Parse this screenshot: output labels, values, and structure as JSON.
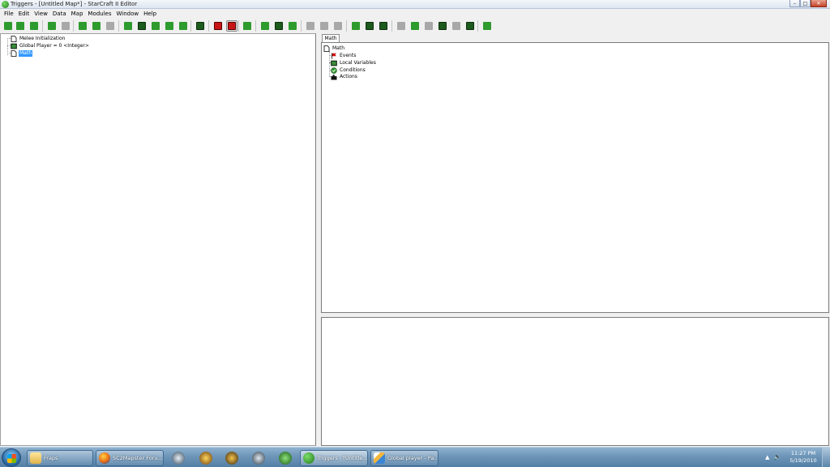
{
  "window": {
    "title": "Triggers - [Untitled Map*] - StarCraft II Editor",
    "minimize_glyph": "–",
    "maximize_glyph": "□",
    "close_glyph": "✕"
  },
  "menu": [
    "File",
    "Edit",
    "View",
    "Data",
    "Map",
    "Modules",
    "Window",
    "Help"
  ],
  "toolbar": {
    "icons": [
      "new-map-icon",
      "open-map-icon",
      "save-map-icon",
      "undo-icon",
      "redo-icon",
      "cut-icon",
      "copy-icon",
      "paste-icon",
      "terrain-editor-icon",
      "trigger-editor-icon",
      "data-editor-icon",
      "text-editor-icon",
      "import-editor-icon",
      "ai-editor-icon",
      "new-trigger-red-icon",
      "new-trigger-pressed-icon",
      "new-folder-icon",
      "new-variable-icon",
      "new-action-def-icon",
      "new-function-icon",
      "flag-icon",
      "arrow-right-icon",
      "new-item-disabled-icon",
      "test-map-icon",
      "run-icon",
      "disabled-a-icon",
      "disabled-b-icon",
      "disabled-c-icon",
      "disabled-d-icon",
      "disabled-e-icon",
      "disabled-f-icon",
      "script-icon",
      "modules-icon"
    ],
    "colors": {
      "green": "#2e9b2e",
      "dark_green": "#1d5a1d",
      "red": "#c81414",
      "gray": "#a8a8a8",
      "blue": "#2f6db5"
    }
  },
  "left_tree": {
    "items": [
      {
        "label": "Melee Initialization",
        "icon": "trigger-icon"
      },
      {
        "label": "Global Player = 0 <Integer>",
        "icon": "variable-icon"
      },
      {
        "label": "Math",
        "icon": "trigger-icon",
        "selected": true
      }
    ]
  },
  "right": {
    "tab_label": "Math",
    "tree": {
      "root": "Math",
      "children": [
        {
          "label": "Events",
          "icon": "flag-icon"
        },
        {
          "label": "Local Variables",
          "icon": "variable-icon"
        },
        {
          "label": "Conditions",
          "icon": "condition-icon"
        },
        {
          "label": "Actions",
          "icon": "action-icon"
        }
      ]
    }
  },
  "taskbar": {
    "tasks": [
      {
        "label": "Fraps",
        "icon": "folder-icon"
      },
      {
        "label": "SC2Mapster Foru...",
        "icon": "firefox-icon"
      },
      {
        "label": "Triggers - [Untitle...",
        "icon": "sc2-editor-icon",
        "active": true
      },
      {
        "label": "Global player - Pa...",
        "icon": "paint-icon"
      }
    ],
    "pinned": [
      "steam-icon",
      "warcraft-icon",
      "hon-icon",
      "starcraft-icon",
      "sc2-icon"
    ],
    "tray": {
      "arrow": "▲",
      "volume": "🔈",
      "time": "11:27 PM",
      "date": "5/19/2010"
    }
  }
}
